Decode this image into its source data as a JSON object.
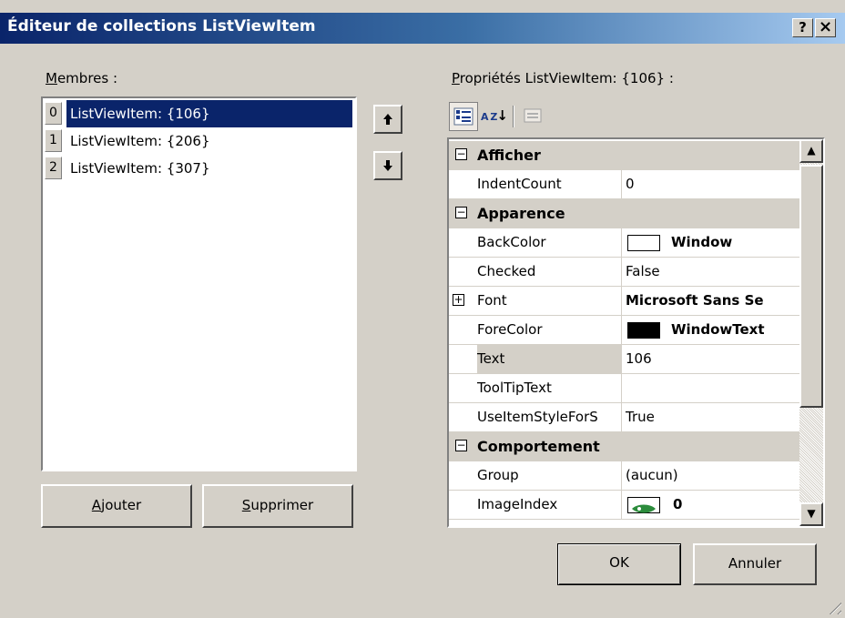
{
  "window": {
    "title": "Éditeur de collections ListViewItem",
    "help_button": "?",
    "close_button": "×"
  },
  "members": {
    "label_accel": "M",
    "label_rest": "embres :",
    "items": [
      {
        "index": "0",
        "text": "ListViewItem: {106}"
      },
      {
        "index": "1",
        "text": "ListViewItem: {206}"
      },
      {
        "index": "2",
        "text": "ListViewItem: {307}"
      }
    ],
    "move_up_icon": "arrow-up-icon",
    "move_down_icon": "arrow-down-icon"
  },
  "buttons": {
    "add_accel": "A",
    "add_rest": "jouter",
    "remove_accel": "S",
    "remove_rest": "upprimer",
    "ok": "OK",
    "cancel": "Annuler"
  },
  "properties": {
    "label_accel": "P",
    "label_rest": "ropriétés ListViewItem: {106} :",
    "toolbar": {
      "categorized_icon": "categorized-icon",
      "alphabetical_label": "A Z",
      "property_pages_icon": "property-pages-icon"
    },
    "rows": {
      "cat_afficher": "Afficher",
      "indentcount_name": "IndentCount",
      "indentcount_value": "0",
      "cat_apparence": "Apparence",
      "backcolor_name": "BackColor",
      "backcolor_value": "Window",
      "backcolor_swatch": "#ffffff",
      "checked_name": "Checked",
      "checked_value": "False",
      "font_name": "Font",
      "font_value": "Microsoft Sans Se",
      "forecolor_name": "ForeColor",
      "forecolor_value": "WindowText",
      "forecolor_swatch": "#000000",
      "text_name": "Text",
      "text_value": "106",
      "tooltip_name": "ToolTipText",
      "tooltip_value": "",
      "useitemstyle_name": "UseItemStyleForS",
      "useitemstyle_value": "True",
      "cat_comportement": "Comportement",
      "group_name": "Group",
      "group_value": "(aucun)",
      "imageindex_name": "ImageIndex",
      "imageindex_value": "0"
    }
  },
  "colors": {
    "title_gradient_start": "#0a246a",
    "title_gradient_end": "#a6caf0",
    "selection": "#0a246a",
    "face": "#d4d0c8"
  }
}
